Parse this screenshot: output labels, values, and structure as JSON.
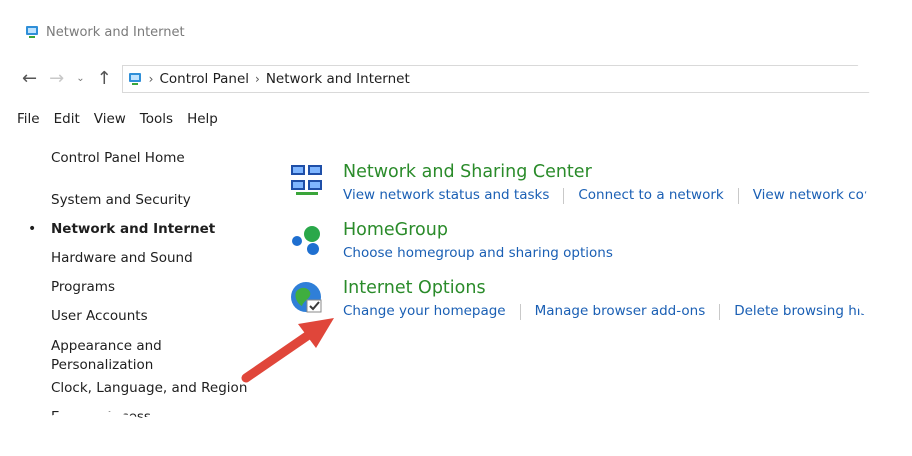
{
  "window": {
    "title": "Network and Internet"
  },
  "address": {
    "crumbs": [
      "Control Panel",
      "Network and Internet"
    ]
  },
  "menu": [
    "File",
    "Edit",
    "View",
    "Tools",
    "Help"
  ],
  "sidebar": {
    "items": [
      {
        "label": "Control Panel Home"
      },
      {
        "label": "System and Security"
      },
      {
        "label": "Network and Internet",
        "active": true
      },
      {
        "label": "Hardware and Sound"
      },
      {
        "label": "Programs"
      },
      {
        "label": "User Accounts"
      },
      {
        "label": "Appearance and Personalization"
      },
      {
        "label": "Clock, Language, and Region"
      },
      {
        "label": "Ease of Access"
      }
    ]
  },
  "groups": [
    {
      "title": "Network and Sharing Center",
      "icon": "network-sharing-icon",
      "links": [
        "View network status and tasks",
        "Connect to a network",
        "View network computers"
      ]
    },
    {
      "title": "HomeGroup",
      "icon": "homegroup-icon",
      "links": [
        "Choose homegroup and sharing options"
      ]
    },
    {
      "title": "Internet Options",
      "icon": "internet-options-icon",
      "links": [
        "Change your homepage",
        "Manage browser add-ons",
        "Delete browsing history"
      ]
    }
  ],
  "colors": {
    "link": "#1a5fb4",
    "group_title": "#2a8b2a",
    "arrow": "#e0463a"
  }
}
